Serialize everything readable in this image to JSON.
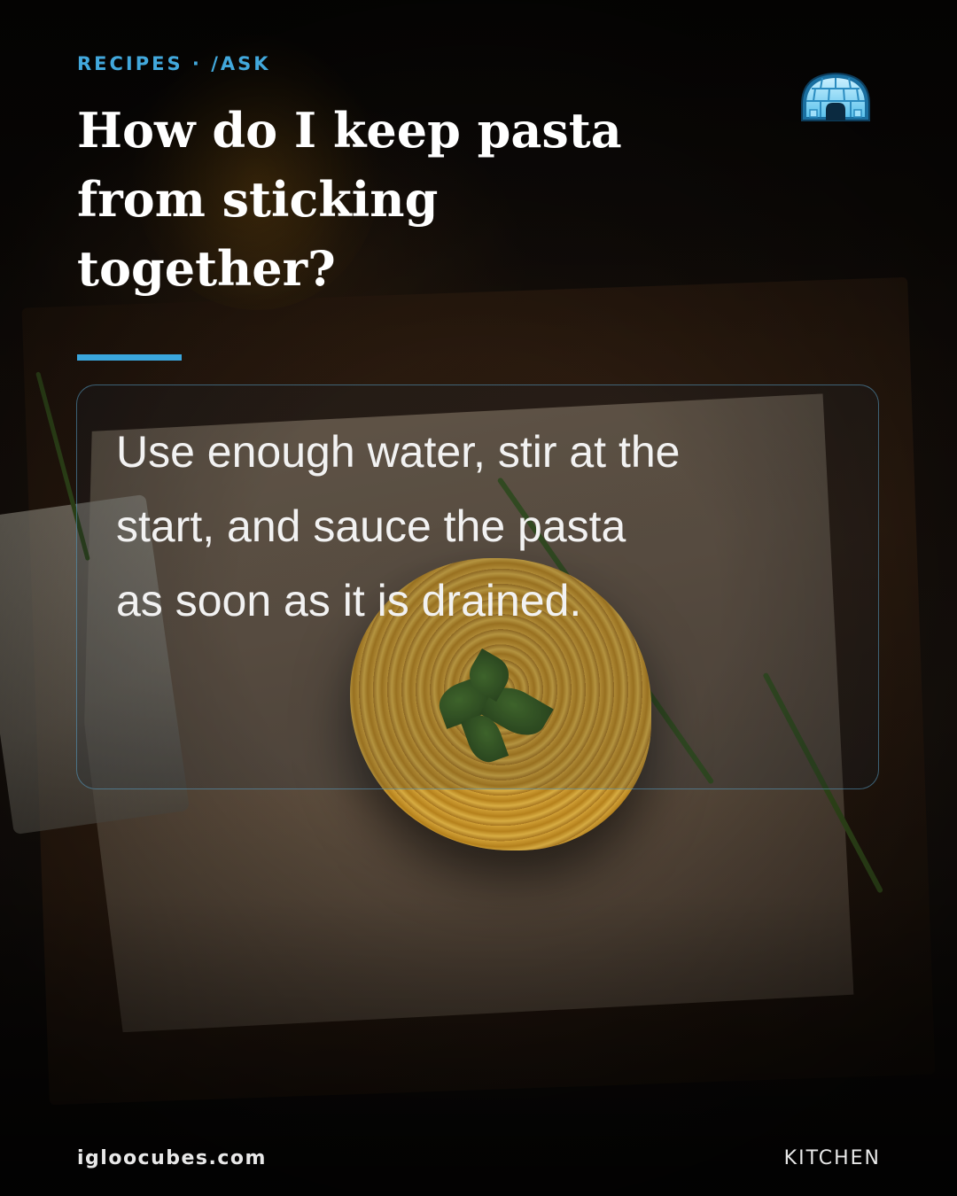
{
  "header": {
    "kicker": "RECIPES · /ASK",
    "title": "How do I keep pasta from sticking together?"
  },
  "answer": {
    "text": "Use enough water, stir at the start, and sauce the pasta as soon as it is drained."
  },
  "brand": {
    "logo_icon": "igloo-icon"
  },
  "footer": {
    "site": "igloocubes.com",
    "tag": "KITCHEN"
  },
  "colors": {
    "accent": "#3aa6dd",
    "kicker": "#42a8dc",
    "title": "#ffffff",
    "card_border": "#5aa0c8"
  }
}
